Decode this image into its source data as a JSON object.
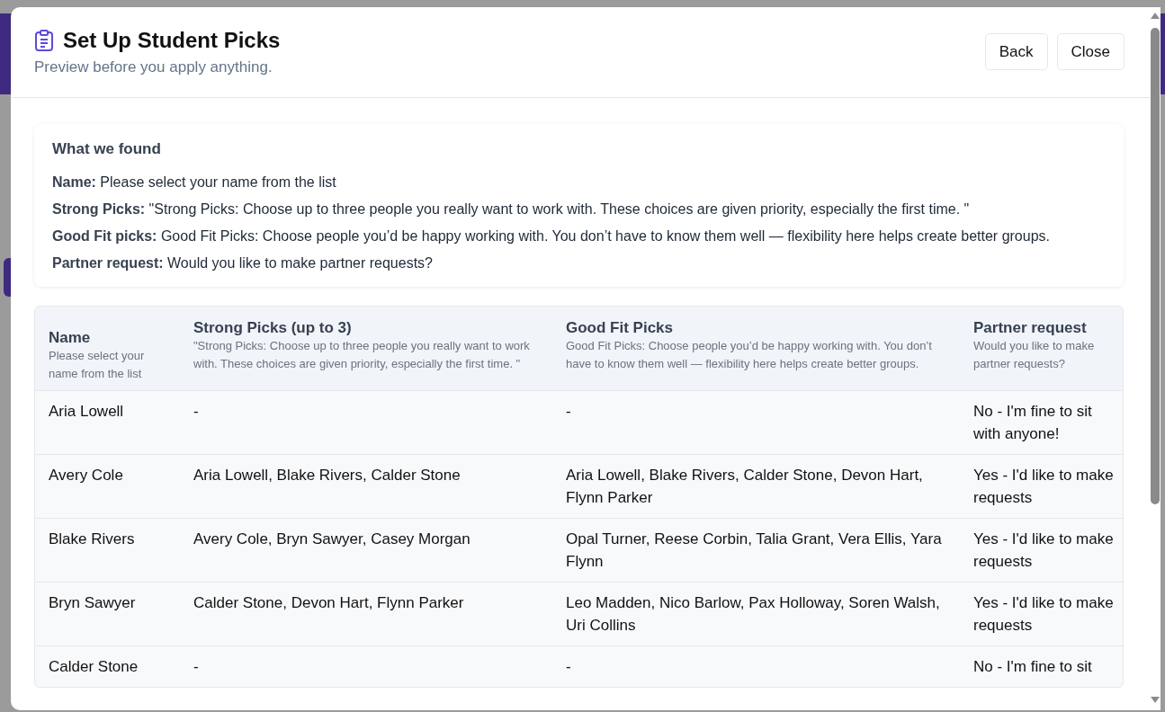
{
  "dialog": {
    "title": "Set Up Student Picks",
    "subtitle": "Preview before you apply anything.",
    "buttons": [
      "Back",
      "Close"
    ]
  },
  "summary": {
    "heading": "What we found",
    "items": [
      "**Name:** Please select your name from the list",
      "**Strong Picks:** \"Strong Picks: Choose up to three people you really want to work with. These choices are given priority, especially the first time. \"",
      "**Good Fit picks:** Good Fit Picks: Choose people you’d be happy working with. You don’t have to know them well — flexibility here helps create better groups.",
      "**Partner request:** Would you like to make partner requests?"
    ]
  },
  "table": {
    "columns": [
      {
        "title": "Name",
        "hint": "Please select your name from the list"
      },
      {
        "title": "Strong Picks (up to 3)",
        "hint": "\"Strong Picks: Choose up to three people you really want to work with. These choices are given priority, especially the first time. \""
      },
      {
        "title": "Good Fit Picks",
        "hint": "Good Fit Picks: Choose people you’d be happy working with. You don’t have to know them well — flexibility here helps create better groups."
      },
      {
        "title": "Partner request",
        "hint": "Would you like to make partner requests?"
      }
    ],
    "rows": [
      [
        "Aria Lowell",
        "-",
        "-",
        "No - I'm fine to sit with anyone!"
      ],
      [
        "Avery Cole",
        "Aria Lowell, Blake Rivers, Calder Stone",
        "Aria Lowell, Blake Rivers, Calder Stone, Devon Hart, Flynn Parker",
        "Yes - I'd like to make requests"
      ],
      [
        "Blake Rivers",
        "Avery Cole, Bryn Sawyer, Casey Morgan",
        "Opal Turner, Reese Corbin, Talia Grant, Vera Ellis, Yara Flynn",
        "Yes - I'd like to make requests"
      ],
      [
        "Bryn Sawyer",
        "Calder Stone, Devon Hart, Flynn Parker",
        "Leo Madden, Nico Barlow, Pax Holloway, Soren Walsh, Uri Collins",
        "Yes - I'd like to make requests"
      ],
      [
        "Calder Stone",
        "-",
        "-",
        "No - I'm fine to sit"
      ]
    ]
  }
}
